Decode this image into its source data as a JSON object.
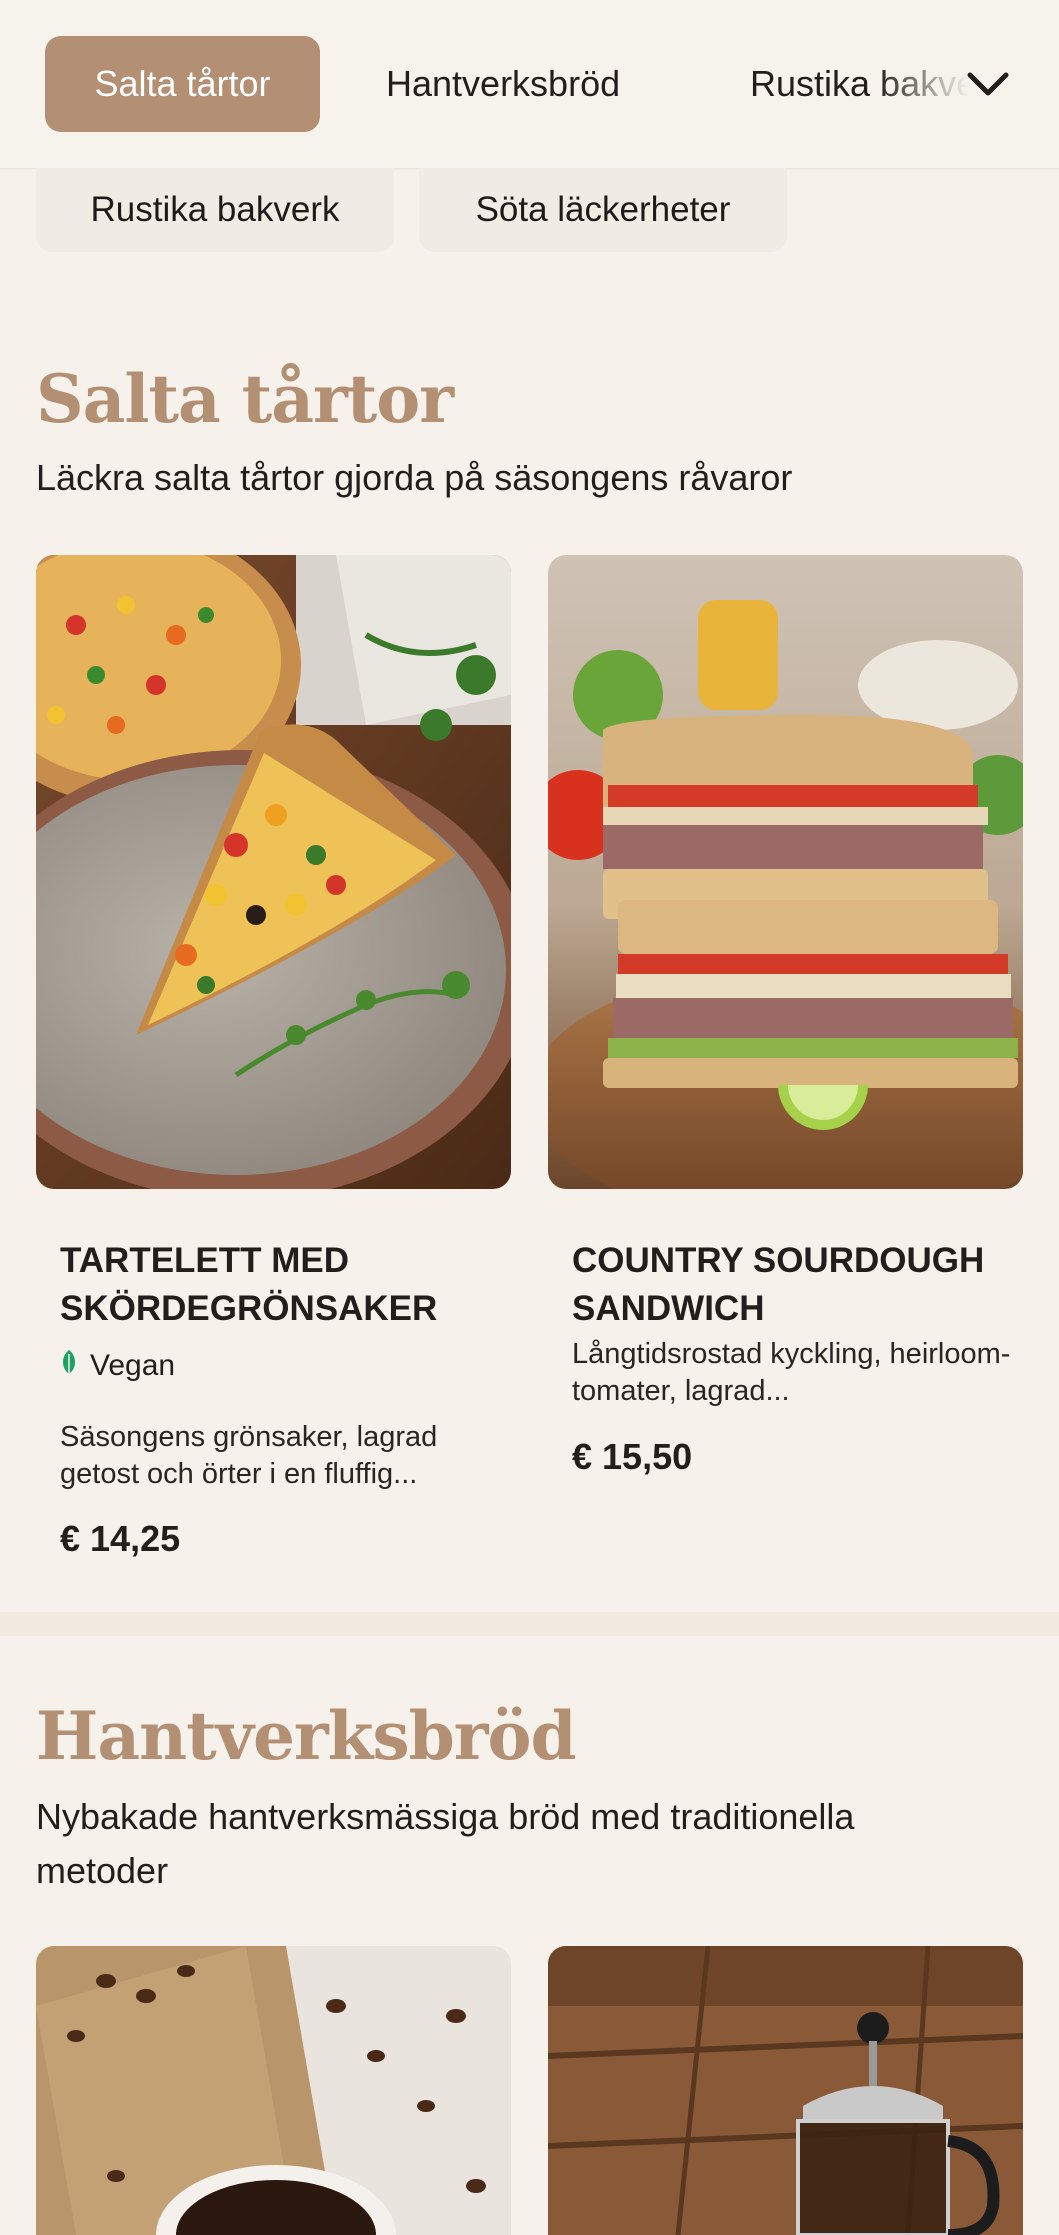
{
  "nav": {
    "tabs": [
      {
        "label": "Salta tårtor",
        "active": true
      },
      {
        "label": "Hantverksbröd",
        "active": false
      },
      {
        "label": "Rustika bakverk",
        "active": false
      }
    ],
    "overflow": [
      {
        "label": "Rustika bakverk"
      },
      {
        "label": "Söta läckerheter"
      }
    ],
    "expand_icon": "chevron-down-icon"
  },
  "sections": [
    {
      "title": "Salta tårtor",
      "subtitle": "Läckra salta tårtor gjorda på säsongens råvaror",
      "items": [
        {
          "title": "TARTELETT MED SKÖRDEGRÖNSAKER",
          "tag": "Vegan",
          "tag_icon": "leaf-icon",
          "description": "Säsongens grönsaker, lagrad getost och örter i en fluffig...",
          "price": "€ 14,25"
        },
        {
          "title": "COUNTRY SOURDOUGH SANDWICH",
          "description": "Långtidsrostad kyckling, heirloom-tomater, lagrad...",
          "price": "€ 15,50"
        }
      ]
    },
    {
      "title": "Hantverksbröd",
      "subtitle": "Nybakade hantverksmässiga bröd med traditionella metoder"
    }
  ],
  "colors": {
    "accent": "#b38f73",
    "background": "#f6f1ea",
    "vegan_green": "#1fa064"
  }
}
